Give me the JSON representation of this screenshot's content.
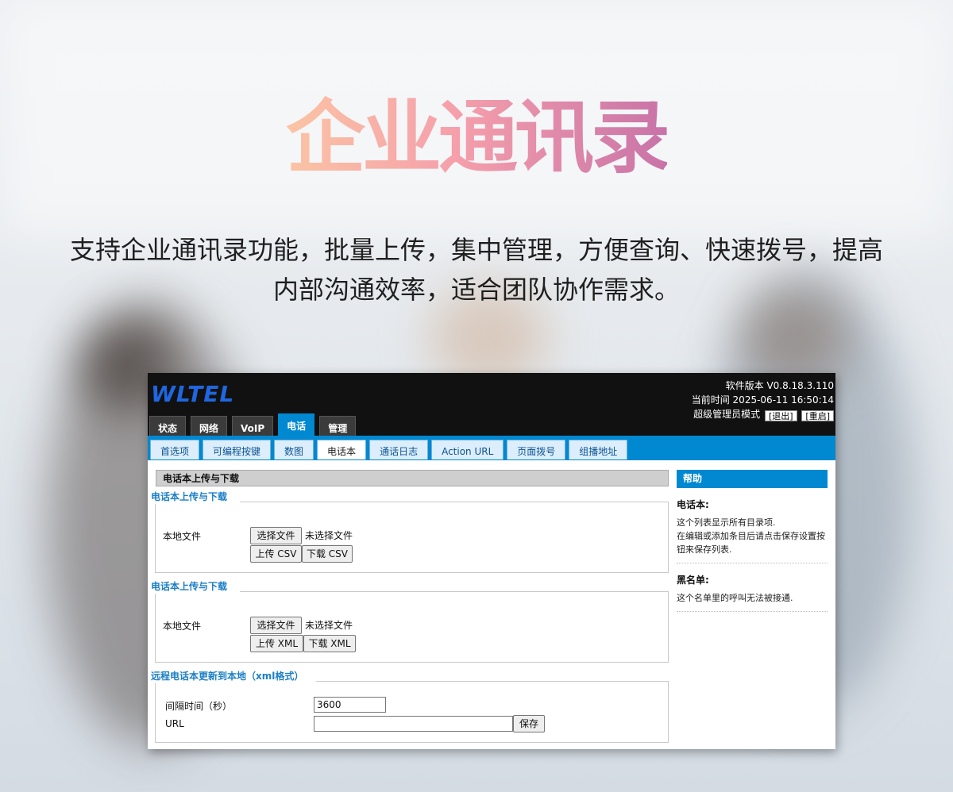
{
  "headline": "企业通讯录",
  "subtitle_line1": "支持企业通讯录功能，批量上传，集中管理，方便查询、快速拨号，提高",
  "subtitle_line2": "内部沟通效率，适合团队协作需求。",
  "app": {
    "logo": "WLTEL",
    "software_version": "软件版本 V0.8.18.3.110",
    "current_time": "当前时间 2025-06-11 16:50:14",
    "mode_label": "超级管理员模式",
    "logout_label": "[退出]",
    "reboot_label": "[重启]",
    "main_tabs": [
      "状态",
      "网络",
      "VoIP",
      "电话",
      "管理"
    ],
    "active_main_tab": "电话",
    "sub_tabs": [
      "首选项",
      "可编程按键",
      "数图",
      "电话本",
      "通话日志",
      "Action URL",
      "页面拨号",
      "组播地址"
    ],
    "active_sub_tab": "电话本"
  },
  "main": {
    "section_title": "电话本上传与下载",
    "csv_group": {
      "legend": "电话本上传与下载",
      "local_file_label": "本地文件",
      "choose_file": "选择文件",
      "no_file": "未选择文件",
      "upload": "上传 CSV",
      "download": "下载 CSV"
    },
    "xml_group": {
      "legend": "电话本上传与下载",
      "local_file_label": "本地文件",
      "choose_file": "选择文件",
      "no_file": "未选择文件",
      "upload": "上传 XML",
      "download": "下载 XML"
    },
    "remote_group": {
      "legend": "远程电话本更新到本地（xml格式）",
      "interval_label": "间隔时间（秒）",
      "interval_value": "3600",
      "url_label": "URL",
      "url_value": "",
      "save": "保存"
    }
  },
  "help": {
    "title": "帮助",
    "phonebook_title": "电话本:",
    "phonebook_line1": "这个列表显示所有目录项.",
    "phonebook_line2": "在编辑或添加条目后请点击保存设置按钮来保存列表.",
    "blacklist_title": "黑名单:",
    "blacklist_text": "这个名单里的呼叫无法被接通."
  },
  "colors": {
    "accent": "#0088d1",
    "logo": "#1f66e0",
    "legend": "#1b7ec6",
    "headline_gradient": [
      "#fbc4a4",
      "#f59fab",
      "#c873a8"
    ]
  }
}
